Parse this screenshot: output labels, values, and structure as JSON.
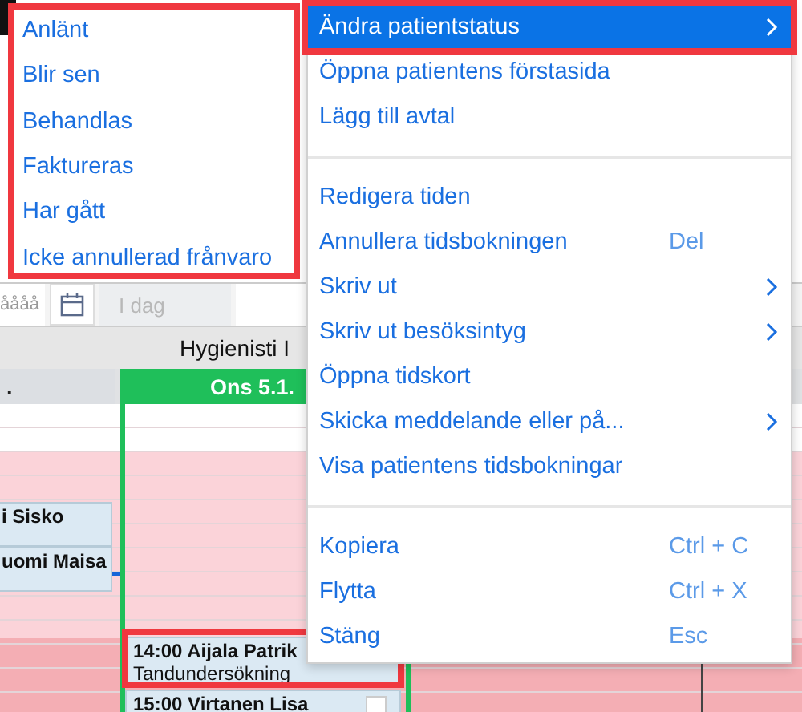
{
  "calendar": {
    "toolbar": {
      "date_field_value": "åååå",
      "today_button": "I dag"
    },
    "resource_title": "Hygienisti I",
    "columns": [
      {
        "label": ".",
        "selected": false,
        "appointments": [
          {
            "title": "i Sisko",
            "highlighted": false
          },
          {
            "title": "uomi Maisa",
            "highlighted": false
          }
        ]
      },
      {
        "label": "Ons 5.1.",
        "selected": true,
        "appointments": [
          {
            "title": "14:00 Aijala Patrik",
            "subtitle": "Tandundersökning",
            "highlighted": true
          },
          {
            "title": "15:00 Virtanen Lisa",
            "highlighted": false,
            "checked": false
          }
        ]
      }
    ]
  },
  "context_menu": {
    "groups": [
      [
        {
          "label": "Ändra patientstatus",
          "selected": true,
          "submenu": true,
          "highlighted": true
        },
        {
          "label": "Öppna patientens förstasida",
          "selected": false,
          "submenu": false,
          "highlighted": false
        },
        {
          "label": "Lägg till avtal",
          "selected": false,
          "submenu": false,
          "highlighted": false
        }
      ],
      [
        {
          "label": "Redigera tiden",
          "selected": false,
          "submenu": false,
          "highlighted": false
        },
        {
          "label": "Annullera tidsbokningen",
          "shortcut": "Del",
          "selected": false,
          "submenu": false,
          "highlighted": false
        },
        {
          "label": "Skriv ut",
          "selected": false,
          "submenu": true,
          "highlighted": false
        },
        {
          "label": "Skriv ut besöksintyg",
          "selected": false,
          "submenu": true,
          "highlighted": false
        },
        {
          "label": "Öppna tidskort",
          "selected": false,
          "submenu": false,
          "highlighted": false
        },
        {
          "label": "Skicka  meddelande eller på...",
          "selected": false,
          "submenu": true,
          "highlighted": false
        },
        {
          "label": "Visa patientens tidsbokningar",
          "selected": false,
          "submenu": false,
          "highlighted": false
        }
      ],
      [
        {
          "label": "Kopiera",
          "shortcut": "Ctrl + C",
          "selected": false,
          "submenu": false,
          "highlighted": false
        },
        {
          "label": "Flytta",
          "shortcut": "Ctrl + X",
          "selected": false,
          "submenu": false,
          "highlighted": false
        },
        {
          "label": "Stäng",
          "shortcut": "Esc",
          "selected": false,
          "submenu": false,
          "highlighted": false
        }
      ]
    ]
  },
  "submenu": {
    "highlighted": true,
    "items": [
      {
        "label": "Anlänt"
      },
      {
        "label": "Blir sen"
      },
      {
        "label": "Behandlas"
      },
      {
        "label": "Faktureras"
      },
      {
        "label": "Har gått"
      },
      {
        "label": "Icke annullerad frånvaro"
      }
    ]
  }
}
